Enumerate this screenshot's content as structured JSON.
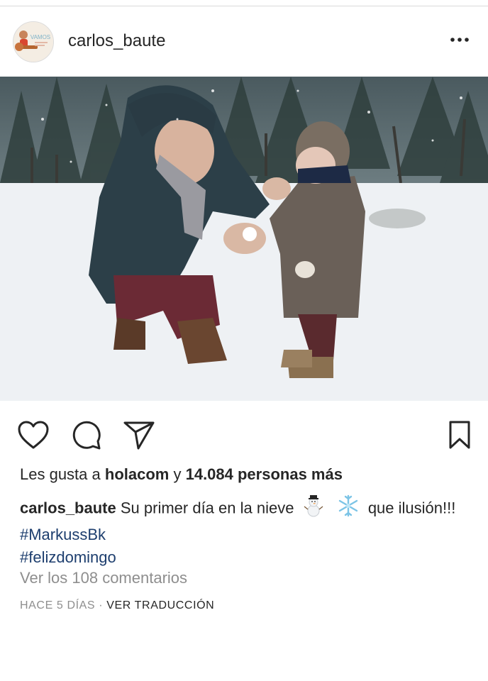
{
  "post": {
    "username": "carlos_baute",
    "avatar_text": "VAMOS",
    "likes": {
      "prefix": "Les gusta a",
      "first_liker": "holacom",
      "connector": "y",
      "others": "14.084 personas más"
    },
    "caption": {
      "username": "carlos_baute",
      "text_1": "Su primer día en la nieve",
      "emoji_1": "snowman-emoji",
      "emoji_2": "snowflake-emoji",
      "text_2": "que ilusión!!!",
      "hashtag_1": "#MarkussBk",
      "hashtag_2": "#felizdomingo"
    },
    "comments_link": "Ver los 108 comentarios",
    "timestamp": "HACE 5 DÍAS",
    "separator": "·",
    "translate_link": "VER TRADUCCIÓN"
  },
  "icons": {
    "more": "more-options-icon",
    "like": "heart-icon",
    "comment": "comment-icon",
    "share": "paper-plane-icon",
    "save": "bookmark-icon"
  },
  "colors": {
    "hashtag": "#1d3e6e",
    "muted_text": "#8e8e8e",
    "primary_text": "#262626"
  }
}
